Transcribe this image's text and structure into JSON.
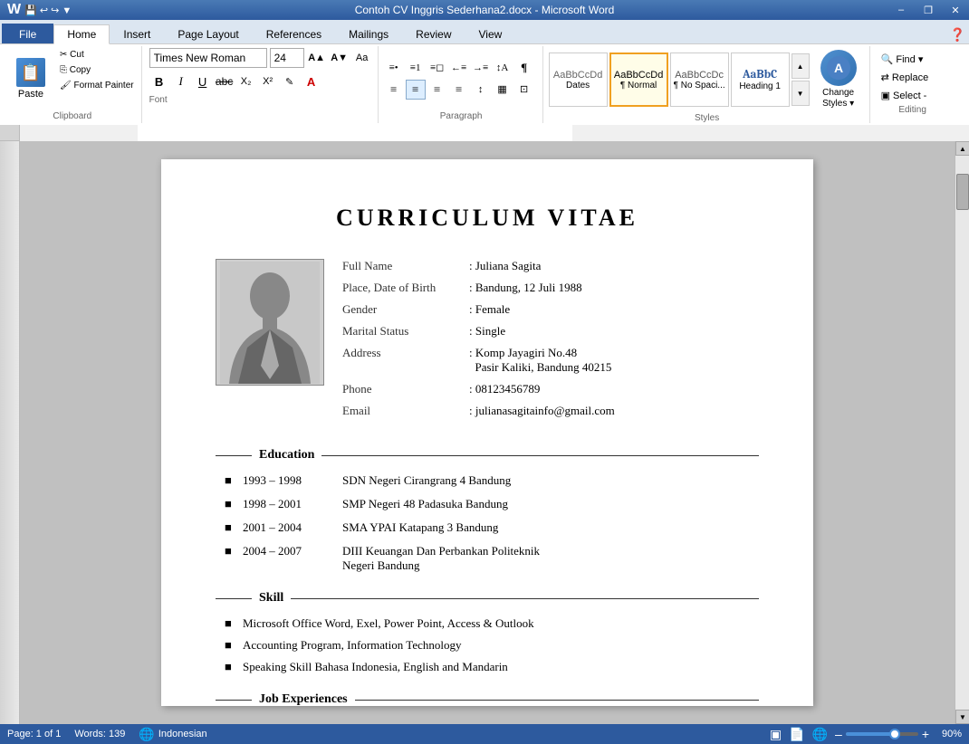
{
  "window": {
    "title": "Contoh CV Inggris Sederhana2.docx - Microsoft Word",
    "minimize": "–",
    "restore": "❐",
    "close": "✕"
  },
  "ribbon": {
    "tabs": [
      "File",
      "Home",
      "Insert",
      "Page Layout",
      "References",
      "Mailings",
      "Review",
      "View"
    ],
    "active_tab": "Home",
    "groups": {
      "clipboard": {
        "label": "Clipboard",
        "paste": "Paste",
        "cut": "✂ Cut",
        "copy": "⎘ Copy",
        "format_painter": "🖌 Format Painter"
      },
      "font": {
        "label": "Font",
        "font_name": "Times New Roman",
        "font_size": "24",
        "increase_size": "A▲",
        "decrease_size": "A▼",
        "clear_format": "Aa",
        "bold": "B",
        "italic": "I",
        "underline": "U",
        "strikethrough": "abc",
        "subscript": "X₂",
        "superscript": "X²",
        "text_color": "A",
        "highlight": "✎"
      },
      "paragraph": {
        "label": "Paragraph",
        "bullet_list": "≡•",
        "numbered_list": "≡1",
        "outline": "≡◻",
        "decrease_indent": "←≡",
        "increase_indent": "→≡",
        "sort": "↕A",
        "show_formatting": "¶",
        "align_left": "≡",
        "align_center": "≡",
        "align_right": "≡",
        "justify": "≡",
        "line_spacing": "↕",
        "shading": "▦",
        "borders": "⊡"
      },
      "styles": {
        "label": "Styles",
        "items": [
          {
            "name": "Dates",
            "preview": "AaBbCcDd",
            "label": "Dates"
          },
          {
            "name": "Normal",
            "preview": "AaBbCcDd",
            "label": "¶ Normal",
            "active": true
          },
          {
            "name": "NoSpacing",
            "preview": "AaBbCcDc",
            "label": "¶ No Spaci..."
          },
          {
            "name": "Heading1",
            "preview": "AaBbC",
            "label": "Heading 1"
          }
        ],
        "change_styles": "Change\nStyles",
        "arrow_up": "▲",
        "arrow_down": "▼",
        "more": "▼"
      },
      "editing": {
        "label": "Editing",
        "find": "🔍 Find ▾",
        "replace": "⇄ Replace",
        "select": "▣ Select -"
      }
    }
  },
  "document": {
    "title": "CURRICULUM VITAE",
    "personal_info": {
      "fields": [
        {
          "label": "Full Name",
          "separator": ":",
          "value": "Juliana Sagita"
        },
        {
          "label": "Place, Date of Birth",
          "separator": ":",
          "value": "Bandung, 12 Juli 1988"
        },
        {
          "label": "Gender",
          "separator": ":",
          "value": "Female"
        },
        {
          "label": "Marital Status",
          "separator": ":",
          "value": "Single"
        },
        {
          "label": "Address",
          "separator": ":",
          "value": "Komp Jayagiri No.48",
          "value2": "Pasir Kaliki, Bandung  40215"
        },
        {
          "label": "Phone",
          "separator": ":",
          "value": "08123456789"
        },
        {
          "label": "Email",
          "separator": ":",
          "value": "julianasagitainfo@gmail.com"
        }
      ]
    },
    "sections": [
      {
        "title": "Education",
        "items": [
          {
            "years": "1993 – 1998",
            "detail": "SDN Negeri Cirangrang 4 Bandung"
          },
          {
            "years": "1998 – 2001",
            "detail": "SMP Negeri 48 Padasuka Bandung"
          },
          {
            "years": "2001 – 2004",
            "detail": "SMA YPAI Katapang 3 Bandung"
          },
          {
            "years": "2004 – 2007",
            "detail": "DIII Keuangan Dan Perbankan Politeknik\nNegeri Bandung"
          }
        ]
      },
      {
        "title": "Skill",
        "items": [
          {
            "detail": "Microsoft Office Word, Exel, Power Point, Access & Outlook"
          },
          {
            "detail": "Accounting Program, Information Technology"
          },
          {
            "detail": "Speaking Skill Bahasa Indonesia, English and Mandarin"
          }
        ]
      },
      {
        "title": "Job Experiences",
        "items": []
      }
    ]
  },
  "status_bar": {
    "page": "Page: 1 of 1",
    "words": "Words: 139",
    "language": "Indonesian",
    "zoom": "90%",
    "zoom_minus": "–",
    "zoom_plus": "+"
  }
}
